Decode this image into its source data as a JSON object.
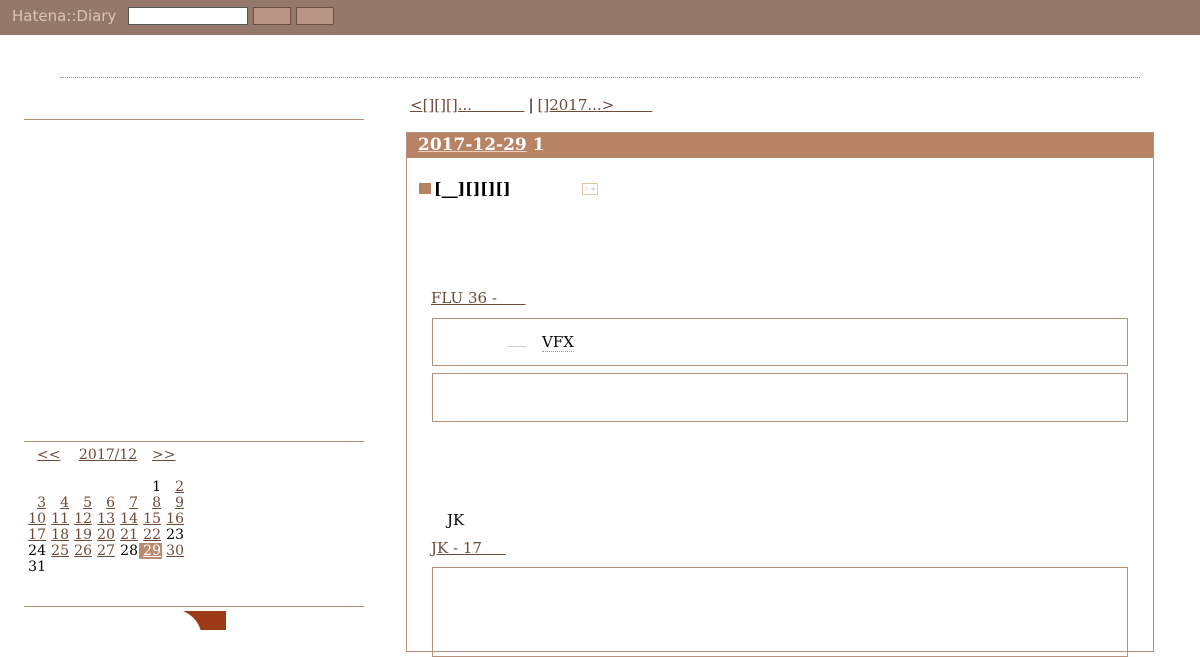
{
  "toolbar": {
    "logo": "Hatena::Diary",
    "search_value": ""
  },
  "sidebar": {
    "calendar": {
      "prev": "<<",
      "month": "2017/12",
      "next": ">>",
      "weeks": [
        [
          "",
          "",
          "",
          "",
          "",
          "1",
          "2"
        ],
        [
          "3",
          "4",
          "5",
          "6",
          "7",
          "8",
          "9"
        ],
        [
          "10",
          "11",
          "12",
          "13",
          "14",
          "15",
          "16"
        ],
        [
          "17",
          "18",
          "19",
          "20",
          "21",
          "22",
          "23"
        ],
        [
          "24",
          "25",
          "26",
          "27",
          "28",
          "29",
          "30"
        ],
        [
          "31",
          "",
          "",
          "",
          "",
          "",
          ""
        ]
      ],
      "today": "29",
      "unlinked_days": [
        "1",
        "23",
        "24",
        "28",
        "31"
      ]
    }
  },
  "main": {
    "pager": {
      "prev": "<[][][]...",
      "separator": "|",
      "next": "[]2017...>"
    },
    "day": {
      "date": "2017-12-29",
      "count": "1",
      "section_title": "[__][][][]",
      "link1": "FLU 36 -",
      "box1_text": "VFX",
      "jk_label": "JK",
      "link2": "JK - 17"
    }
  },
  "colors": {
    "toolbar_bg": "#94796a",
    "accent": "#b88265",
    "link": "#6e4a36",
    "border": "#b8917c"
  }
}
